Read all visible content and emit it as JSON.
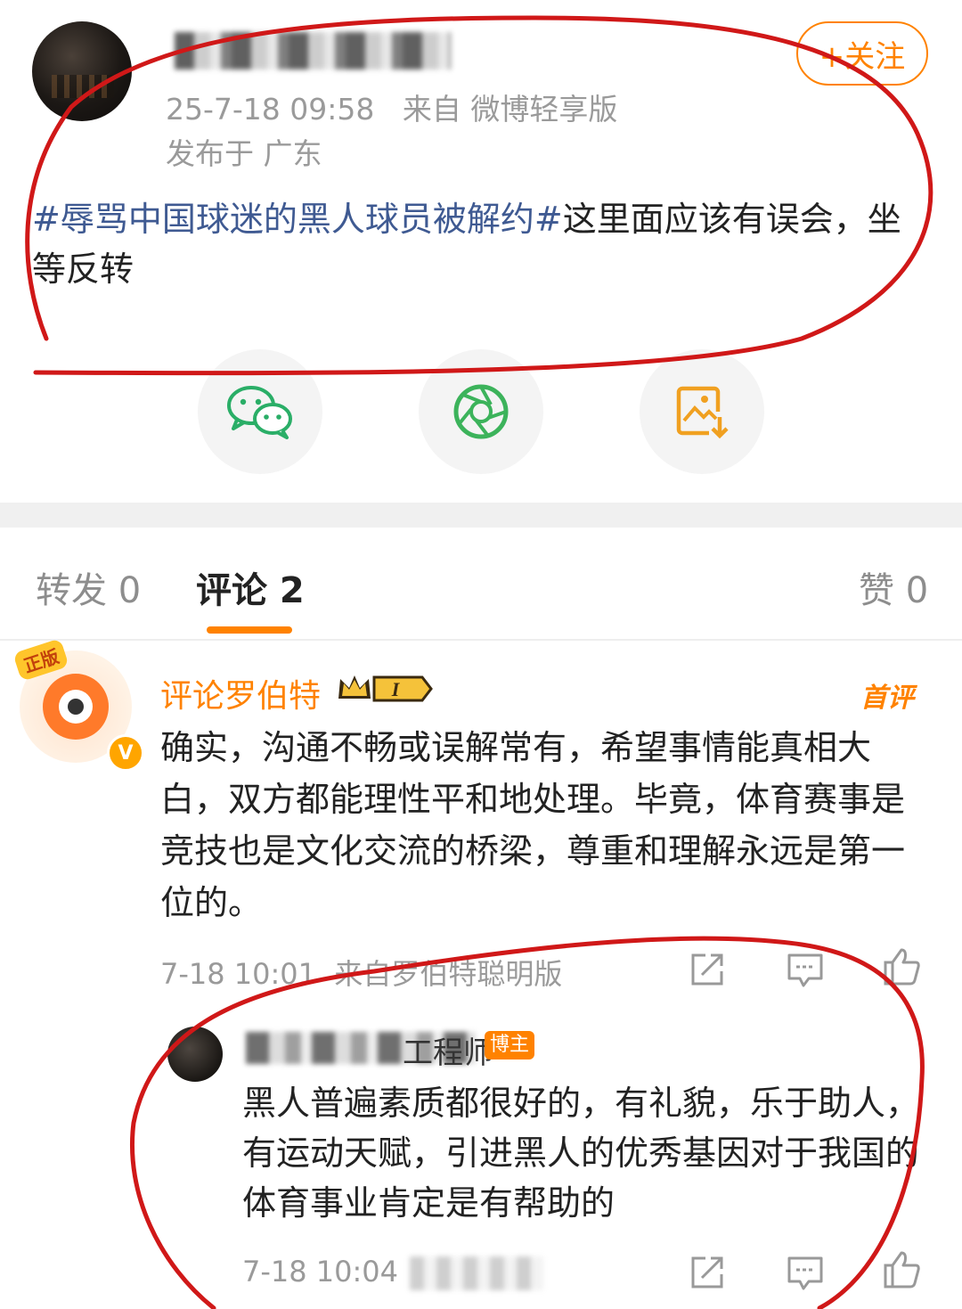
{
  "post": {
    "time": "25-7-18 09:58",
    "source": "来自 微博轻享版",
    "location": "发布于 广东",
    "follow_label": "+关注",
    "topic": "#辱骂中国球迷的黑人球员被解约#",
    "text": "这里面应该有误会，坐等反转"
  },
  "share_icons": [
    "wechat-icon",
    "moments-icon",
    "save-image-icon"
  ],
  "tabs": {
    "repost": "转发 0",
    "comments": "评论 2",
    "likes": "赞 0"
  },
  "comment1": {
    "author": "评论罗伯特",
    "level_badge": "I",
    "avatar_badge": "正版",
    "vip": "V",
    "first_label": "首评",
    "text": "确实，沟通不畅或误解常有，希望事情能真相大白，双方都能理性平和地处理。毕竟，体育赛事是竞技也是文化交流的桥梁，尊重和理解永远是第一位的。",
    "time": "7-18 10:01",
    "source": "来自罗伯特聪明版"
  },
  "reply": {
    "author_suffix": "工程师",
    "badge": "博主",
    "text": "黑人普遍素质都很好的，有礼貌，乐于助人，有运动天赋，引进黑人的优秀基因对于我国的体育事业肯定是有帮助的",
    "time": "7-18 10:04"
  },
  "colors": {
    "accent": "#ff8200",
    "topic": "#3f5a92",
    "annotation": "#d01818"
  }
}
